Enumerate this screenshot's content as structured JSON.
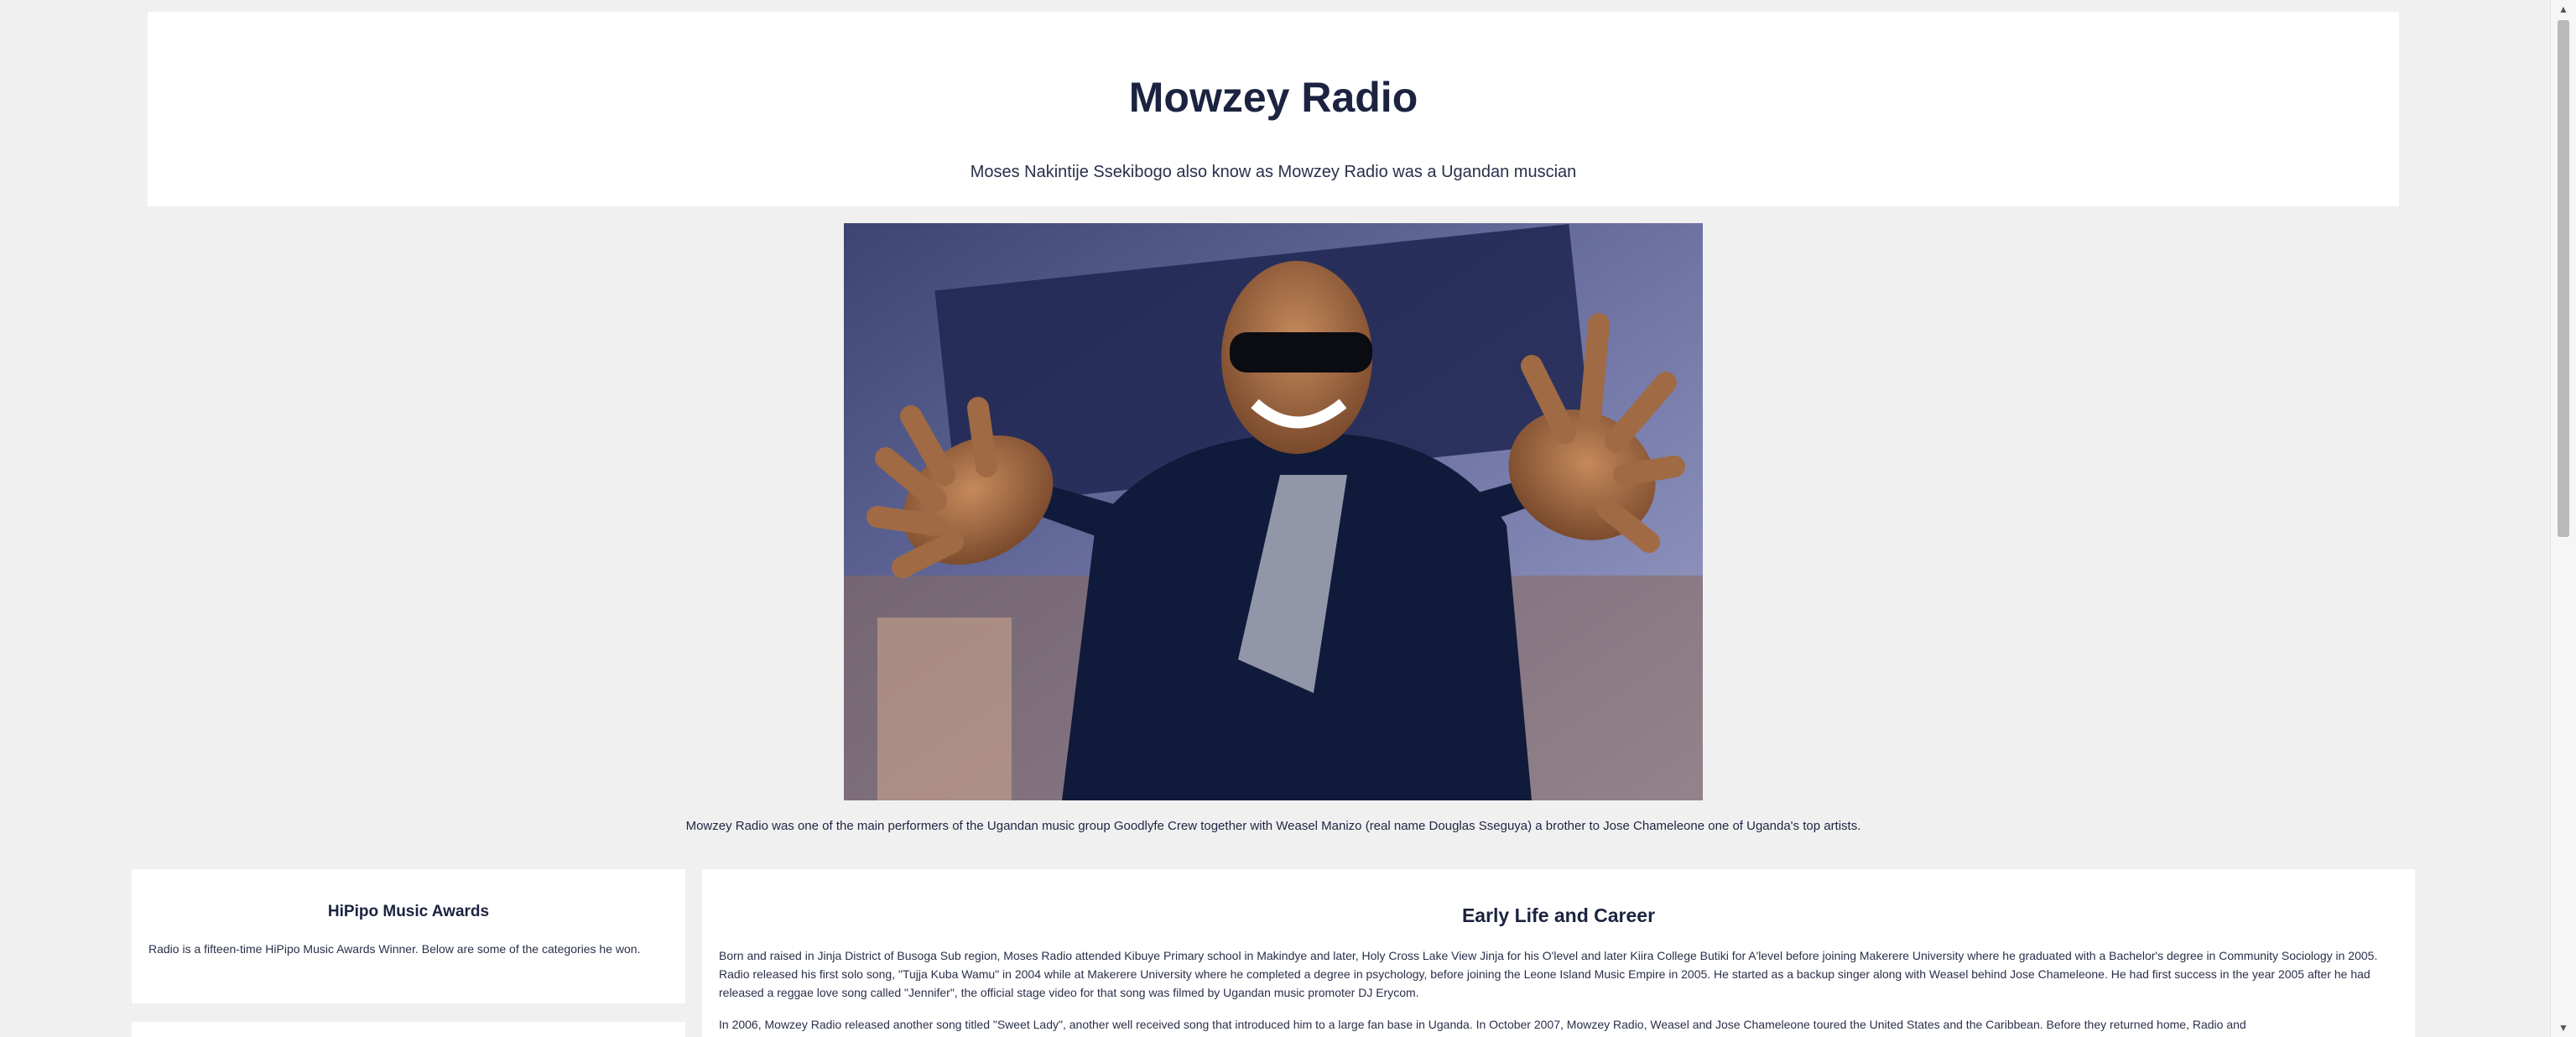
{
  "header": {
    "title": "Mowzey Radio",
    "subtitle": "Moses Nakintije Ssekibogo also know as Mowzey Radio was a Ugandan muscian"
  },
  "hero": {
    "caption": "Mowzey Radio was one of the main performers of the Ugandan music group Goodlyfe Crew together with Weasel Manizo (real name Douglas Sseguya) a brother to Jose Chameleone one of Uganda's top artists."
  },
  "sidebar": {
    "title": "HiPipo Music Awards",
    "text": "Radio is a fifteen-time HiPipo Music Awards Winner. Below are some of the categories he won."
  },
  "main": {
    "title": "Early Life and Career",
    "paragraph_1": "Born and raised in Jinja District of Busoga Sub region, Moses Radio attended Kibuye Primary school in Makindye and later, Holy Cross Lake View Jinja for his O'level and later Kiira College Butiki for A'level before joining Makerere University where he graduated with a Bachelor's degree in Community Sociology in 2005. Radio released his first solo song, \"Tujja Kuba Wamu\" in 2004 while at Makerere University where he completed a degree in psychology, before joining the Leone Island Music Empire in 2005. He started as a backup singer along with Weasel behind Jose Chameleone. He had first success in the year 2005 after he had released a reggae love song called \"Jennifer\", the official stage video for that song was filmed by Ugandan music promoter DJ Erycom.",
    "paragraph_2": "In 2006, Mowzey Radio released another song titled \"Sweet Lady\", another well received song that introduced him to a large fan base in Uganda. In October 2007, Mowzey Radio, Weasel and Jose Chameleone toured the United States and the Caribbean. Before they returned home, Radio and"
  },
  "scrollbar": {
    "up_arrow": "▲",
    "down_arrow": "▼"
  }
}
